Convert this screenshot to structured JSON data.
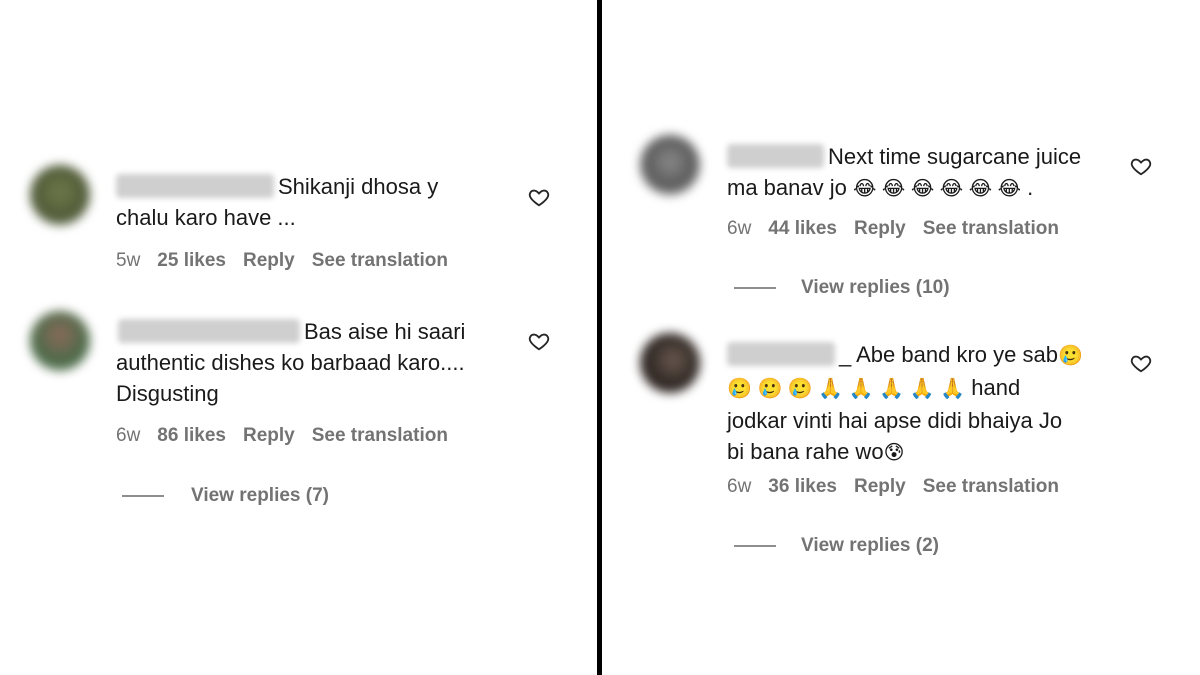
{
  "comments": [
    {
      "text_line1": "Shikanji dhosa y",
      "text_line2": "chalu karo have ...",
      "time": "5w",
      "likes": "25 likes",
      "reply": "Reply",
      "see_translation": "See translation"
    },
    {
      "text_line1": "Bas aise hi saari",
      "text_line2": "authentic dishes ko barbaad karo....",
      "text_line3": "Disgusting",
      "time": "6w",
      "likes": "86 likes",
      "reply": "Reply",
      "see_translation": "See translation",
      "view_replies": "View replies (7)"
    },
    {
      "text_line1": "Next time sugarcane juice",
      "text_line2": "ma banav jo",
      "emoji": "😂 😂 😂 😂 😂 😂",
      "trail": ".",
      "time": "6w",
      "likes": "44 likes",
      "reply": "Reply",
      "see_translation": "See translation",
      "view_replies": "View replies (10)"
    },
    {
      "text_line1": "_ Abe band kro ye sab",
      "emoji_a": "🥲",
      "emoji_b": "🥲 🥲 🥲 🙏 🙏 🙏 🙏 🙏",
      "text_line2": "hand",
      "text_line3": "jodkar vinti hai apse didi bhaiya Jo",
      "text_line4": "bi bana rahe wo",
      "emoji_c": "😰",
      "time": "6w",
      "likes": "36 likes",
      "reply": "Reply",
      "see_translation": "See translation",
      "view_replies": "View replies (2)"
    }
  ],
  "colors": {
    "meta": "#737373",
    "divider": "#000000",
    "text": "#1a1a1a"
  },
  "icons": {
    "like": "heart-outline-icon"
  }
}
